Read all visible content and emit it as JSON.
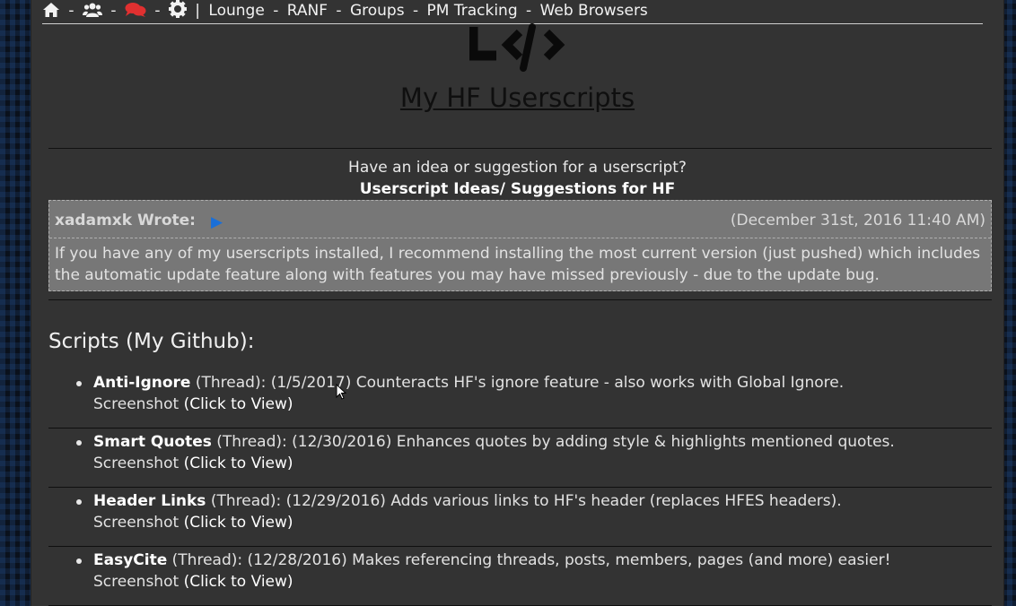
{
  "nav": {
    "sep": "-",
    "pipe": "|",
    "links": [
      "Lounge",
      "RANF",
      "Groups",
      "PM Tracking",
      "Web Browsers"
    ],
    "icons": [
      "home-icon",
      "users-icon",
      "chat-icon",
      "gear-icon"
    ],
    "chat_icon_color": "#e03030"
  },
  "page": {
    "title": "My HF Userscripts",
    "idea_question": "Have an idea or suggestion for a userscript?",
    "idea_link": "Userscript Ideas/ Suggestions for HF"
  },
  "quote": {
    "author": "xadamxk Wrote:",
    "date": "(December 31st, 2016 11:40 AM)",
    "body": "If you have any of my userscripts installed, I recommend installing the most current version (just pushed) which includes the automatic update feature along with features you may have missed previously - due to the update bug."
  },
  "scripts": {
    "heading": "Scripts (My Github):",
    "items": [
      {
        "name": "Anti-Ignore",
        "thread": "(Thread):",
        "desc": "(1/5/2017) Counteracts HF's ignore feature - also works with Global Ignore.",
        "screenshot": "Screenshot",
        "click": "(Click to View)"
      },
      {
        "name": "Smart Quotes",
        "thread": "(Thread):",
        "desc": "(12/30/2016) Enhances quotes by adding style & highlights mentioned quotes.",
        "screenshot": "Screenshot",
        "click": "(Click to View)"
      },
      {
        "name": "Header Links",
        "thread": "(Thread):",
        "desc": "(12/29/2016) Adds various links to HF's header (replaces HFES headers).",
        "screenshot": "Screenshot",
        "click": "(Click to View)"
      },
      {
        "name": "EasyCite",
        "thread": "(Thread):",
        "desc": "(12/28/2016) Makes referencing threads, posts, members, pages (and more) easier!",
        "screenshot": "Screenshot",
        "click": "(Click to View)"
      }
    ]
  }
}
